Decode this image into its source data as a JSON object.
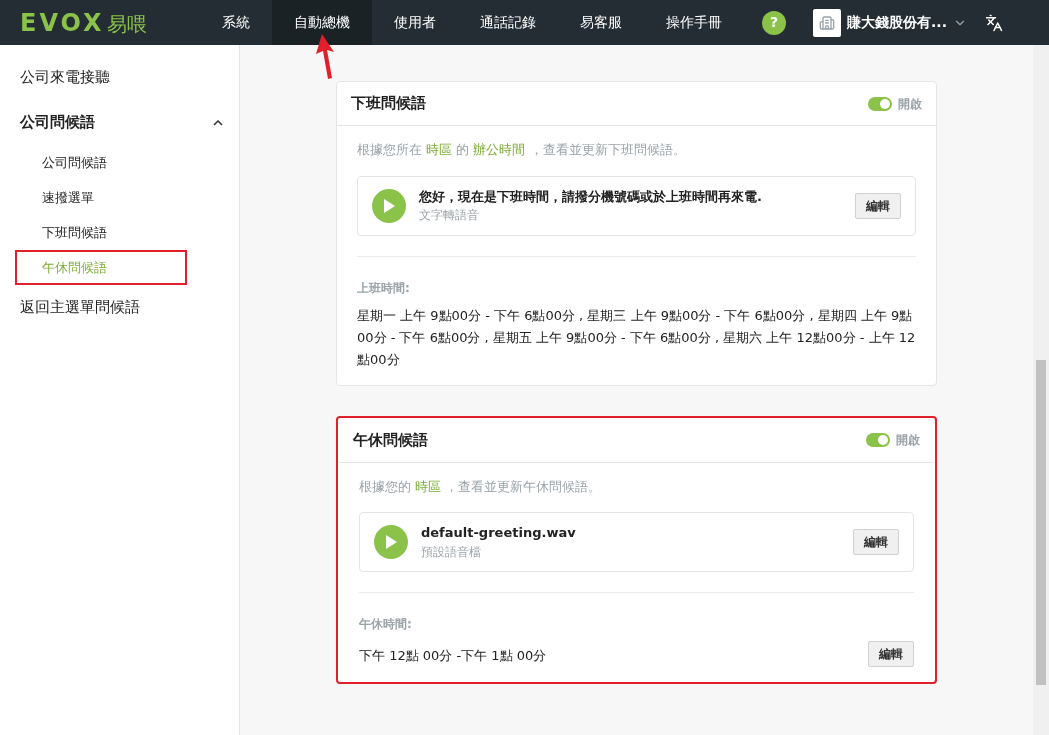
{
  "header": {
    "logo": "EVOX",
    "logo_suffix": "易喂",
    "nav": [
      {
        "label": "系統",
        "selected": false,
        "pointed": false
      },
      {
        "label": "自動總機",
        "selected": true,
        "pointed": true
      },
      {
        "label": "使用者",
        "selected": false,
        "pointed": false
      },
      {
        "label": "通話記錄",
        "selected": false,
        "pointed": false
      },
      {
        "label": "易客服",
        "selected": false,
        "pointed": false
      },
      {
        "label": "操作手冊",
        "selected": false,
        "pointed": false
      }
    ],
    "help": "?",
    "company": "賺大錢股份有..."
  },
  "sidebar": {
    "items": [
      {
        "label": "公司來電接聽"
      },
      {
        "label": "公司問候語",
        "expanded": true,
        "children": [
          {
            "label": "公司問候語",
            "selected": false,
            "highlighted": false
          },
          {
            "label": "速撥選單",
            "selected": false,
            "highlighted": false
          },
          {
            "label": "下班問候語",
            "selected": false,
            "highlighted": false
          },
          {
            "label": "午休問候語",
            "selected": true,
            "highlighted": true
          }
        ]
      },
      {
        "label": "返回主選單問候語"
      }
    ]
  },
  "cards": [
    {
      "title": "下班問候語",
      "on": true,
      "toggle_label": "開啟",
      "highlighted": false,
      "description": [
        {
          "text": "根據您所在 ",
          "link": false
        },
        {
          "text": "時區",
          "link": true
        },
        {
          "text": " 的 ",
          "link": false
        },
        {
          "text": "辦公時間",
          "link": true
        },
        {
          "text": " ，查看並更新下班問候語。",
          "link": false
        }
      ],
      "greeting": {
        "title": "您好，現在是下班時間，請撥分機號碼或於上班時間再來電.",
        "subtitle": "文字轉語音",
        "button": "編輯"
      },
      "schedule": {
        "label": "上班時間:",
        "value": "星期一 上午 9點00分 - 下午 6點00分 , 星期三 上午 9點00分 - 下午 6點00分 , 星期四 上午 9點00分 - 下午 6點00分 , 星期五 上午 9點00分 - 下午 6點00分 , 星期六 上午 12點00分 - 上午 12點00分"
      }
    },
    {
      "title": "午休問候語",
      "on": true,
      "toggle_label": "開啟",
      "highlighted": true,
      "description": [
        {
          "text": "根據您的 ",
          "link": false
        },
        {
          "text": "時區",
          "link": true
        },
        {
          "text": " ，查看並更新午休問候語。",
          "link": false
        }
      ],
      "greeting": {
        "title": "default-greeting.wav",
        "subtitle": "預設語音檔",
        "button": "編輯"
      },
      "schedule": {
        "label": "午休時間:",
        "value": "下午 12點 00分 -下午 1點 00分",
        "button": "編輯"
      }
    }
  ]
}
